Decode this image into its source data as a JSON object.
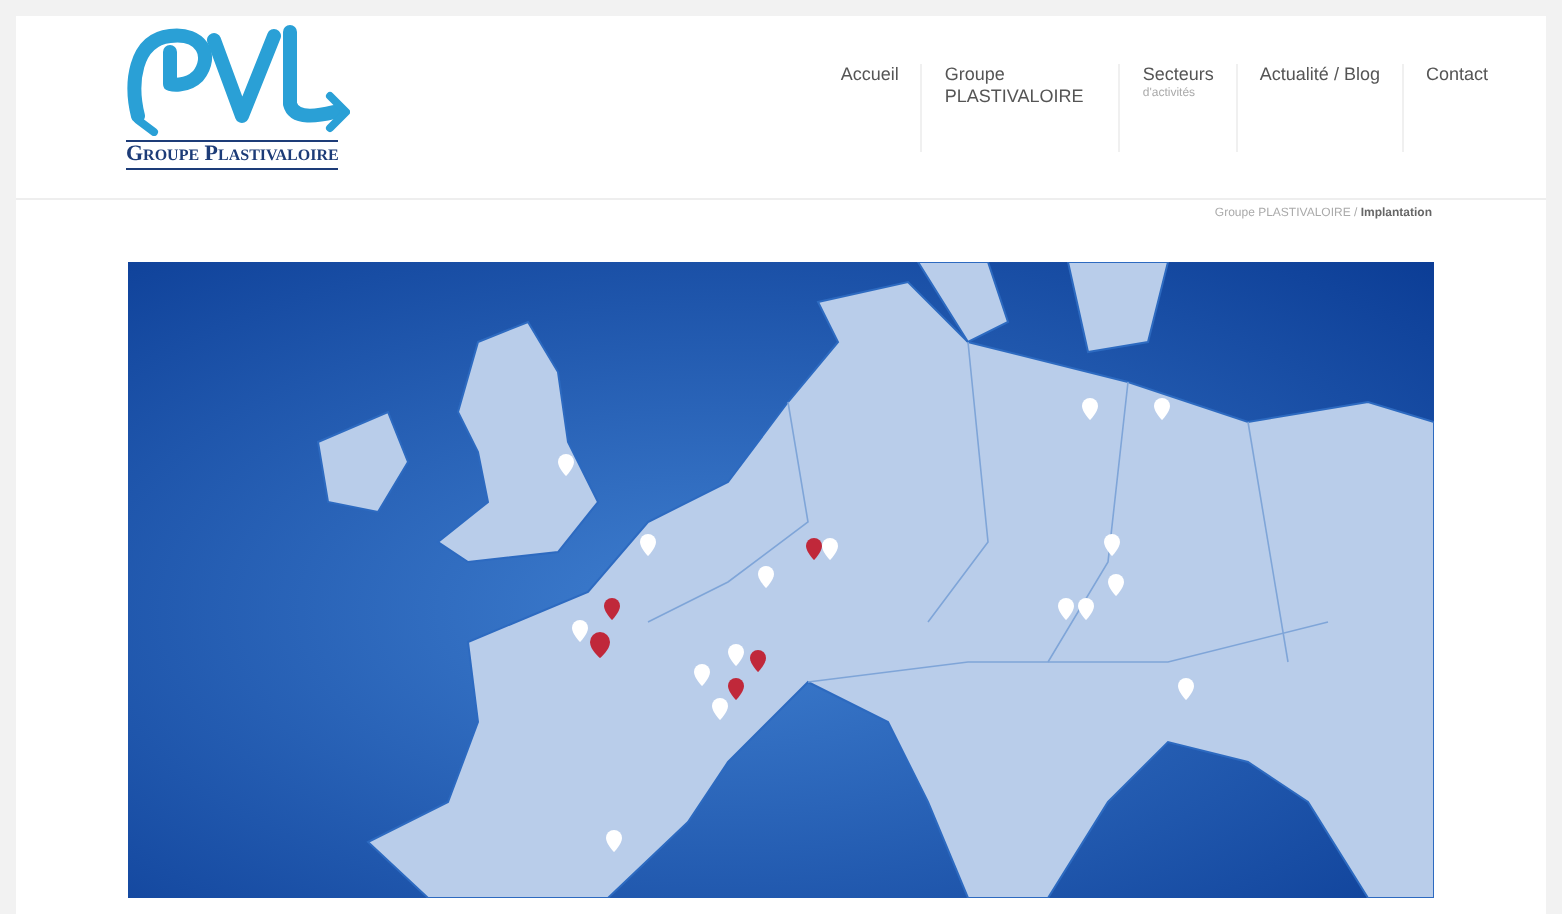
{
  "logo": {
    "caption": "Groupe Plastivaloire"
  },
  "nav": [
    {
      "label": "Accueil"
    },
    {
      "label": "Groupe PLASTIVALOIRE"
    },
    {
      "label": "Secteurs",
      "sublabel": "d'activités"
    },
    {
      "label": "Actualité / Blog"
    },
    {
      "label": "Contact"
    }
  ],
  "breadcrumb": {
    "path": "Groupe PLASTIVALOIRE",
    "separator": "/",
    "current": "Implantation"
  }
}
